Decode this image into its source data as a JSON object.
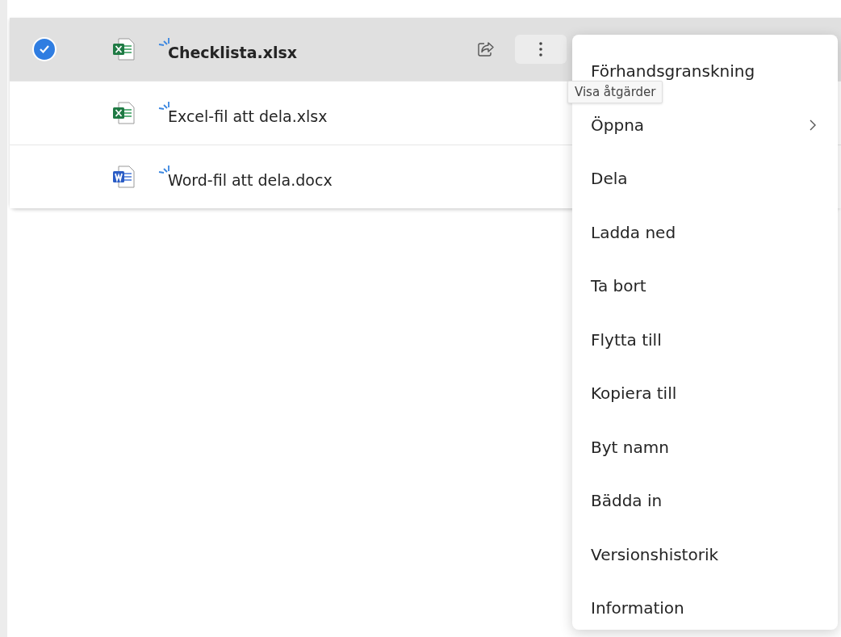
{
  "files": [
    {
      "name": "Checklista.xlsx",
      "kind": "excel",
      "selected": true
    },
    {
      "name": "Excel-fil att dela.xlsx",
      "kind": "excel",
      "selected": false
    },
    {
      "name": "Word-fil att dela.docx",
      "kind": "word",
      "selected": false
    }
  ],
  "context_menu": {
    "items": [
      {
        "label": "Förhandsgranskning",
        "submenu": false
      },
      {
        "label": "Öppna",
        "submenu": true
      },
      {
        "label": "Dela",
        "submenu": false
      },
      {
        "label": "Ladda ned",
        "submenu": false
      },
      {
        "label": "Ta bort",
        "submenu": false
      },
      {
        "label": "Flytta till",
        "submenu": false
      },
      {
        "label": "Kopiera till",
        "submenu": false
      },
      {
        "label": "Byt namn",
        "submenu": false
      },
      {
        "label": "Bädda in",
        "submenu": false
      },
      {
        "label": "Versionshistorik",
        "submenu": false
      },
      {
        "label": "Information",
        "submenu": false
      }
    ]
  },
  "tooltip": {
    "text": "Visa åtgärder"
  }
}
